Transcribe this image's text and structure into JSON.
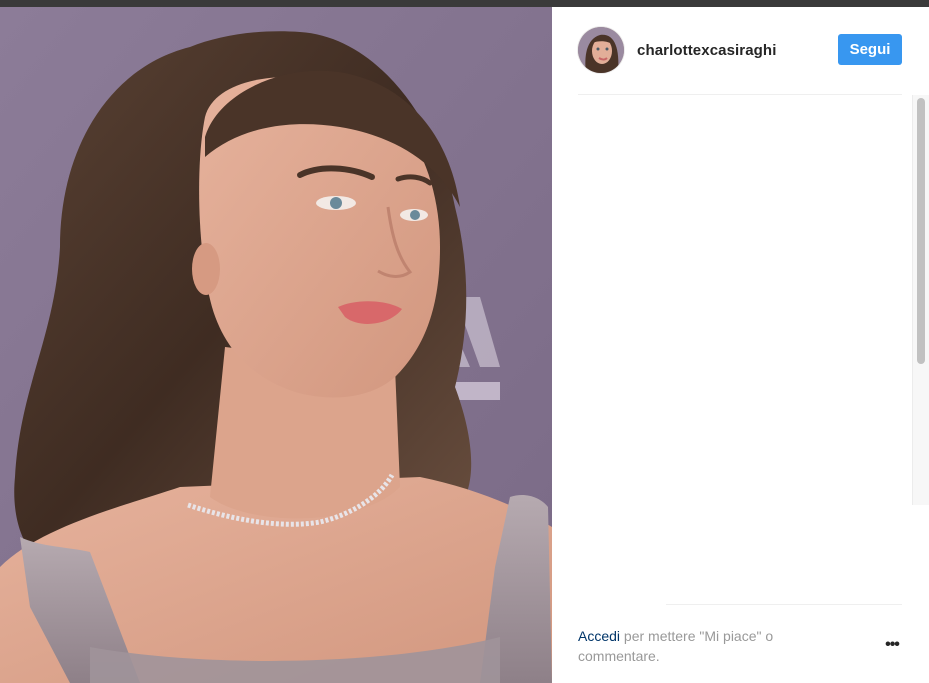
{
  "post": {
    "username": "charlottexcasiraghi",
    "follow_label": "Segui",
    "login_link": "Accedi",
    "login_rest": " per mettere \"Mi piace\" o commentare.",
    "more_label": "•••"
  },
  "icons": {
    "more": "more-options-icon"
  },
  "colors": {
    "follow_button": "#3897f0",
    "login_link": "#003569",
    "muted_text": "#999999",
    "photo_background": "#8a7a96"
  }
}
